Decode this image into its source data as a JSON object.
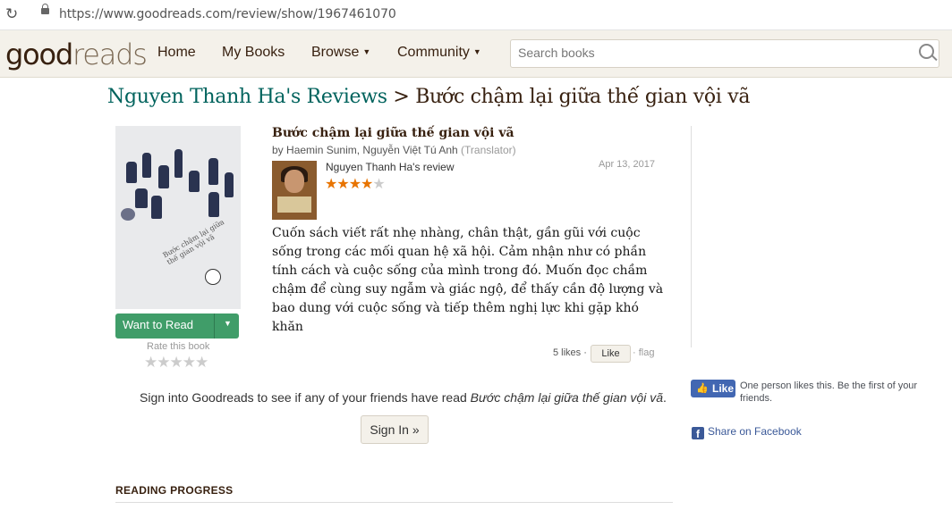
{
  "browser": {
    "url": "https://www.goodreads.com/review/show/1967461070"
  },
  "header": {
    "logo_bold": "good",
    "logo_light": "reads",
    "nav": [
      "Home",
      "My Books",
      "Browse",
      "Community"
    ],
    "search_placeholder": "Search books"
  },
  "page": {
    "user_reviews": "Nguyen Thanh Ha's Reviews",
    "separator": " > ",
    "book_title": "Bước chậm lại giữa thế gian vội vã"
  },
  "book": {
    "cover_text": "Bước chậm lại giữa thế gian vội vã",
    "want_to_read": "Want to Read",
    "rate_label": "Rate this book",
    "rate_stars": "★★★★★"
  },
  "review": {
    "title": "Bước chậm lại giữa thế gian vội vã",
    "by": "by",
    "authors": "Haemin Sunim, Nguyễn Việt Tú Anh",
    "role": "(Translator)",
    "reviewer": "Nguyen Thanh Ha's review",
    "date": "Apr 13, 2017",
    "rating": 4,
    "stars_on": "★★★★",
    "stars_off": "★",
    "body": "Cuốn sách viết rất nhẹ nhàng, chân thật, gần gũi với cuộc sống trong các mối quan hệ xã hội. Cảm nhận như có phần tính cách và cuộc sống của mình trong đó. Muốn đọc chầm chậm để cùng suy ngẫm và giác ngộ, để thấy cần độ lượng và bao dung với cuộc sống và tiếp thêm nghị lực khi gặp khó khăn",
    "likes": "5 likes ·",
    "like_button": "Like",
    "flag": "· flag"
  },
  "signin": {
    "text_prefix": "Sign into Goodreads to see if any of your friends have read ",
    "text_book": "Bước chậm lại giữa thế gian vội vã",
    "text_suffix": ".",
    "button": "Sign In »"
  },
  "reading_progress": "READING PROGRESS",
  "facebook": {
    "like_label": "Like",
    "like_text": "One person likes this. Be the first of your friends.",
    "share_label": "Share on Facebook"
  },
  "colors": {
    "goodreads_green": "#00635d",
    "star": "#e87400",
    "want_to_read": "#409d69",
    "facebook_blue": "#4267b2"
  }
}
